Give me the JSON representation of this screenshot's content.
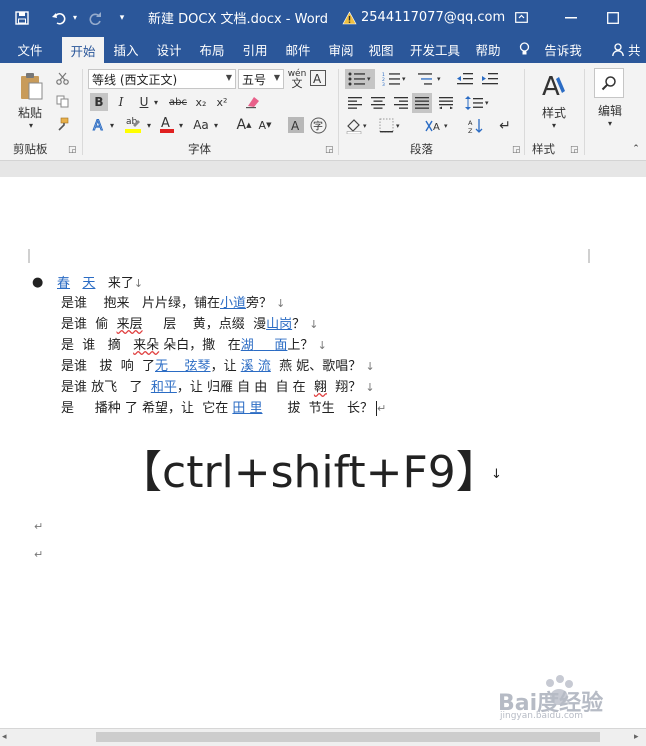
{
  "titlebar": {
    "title": "新建 DOCX 文档.docx  -  Word",
    "account": "2544117077@qq.com"
  },
  "tabs": [
    "文件",
    "开始",
    "插入",
    "设计",
    "布局",
    "引用",
    "邮件",
    "审阅",
    "视图",
    "开发工具",
    "帮助",
    "告诉我",
    "共"
  ],
  "ribbon": {
    "clipboard": {
      "paste": "粘贴",
      "label": "剪贴板"
    },
    "font": {
      "font_name": "等线 (西文正文)",
      "font_size": "五号",
      "wen": "wén",
      "bold": "B",
      "italic": "I",
      "underline": "U",
      "strike": "abc",
      "sub": "x₂",
      "sup": "x²",
      "grow": "A",
      "shrink": "A",
      "case": "Aa",
      "label": "字体"
    },
    "paragraph": {
      "label": "段落"
    },
    "styles": {
      "button": "样式",
      "label": "样式"
    },
    "editing": {
      "button": "编辑"
    }
  },
  "document": {
    "line1": {
      "a": "春",
      "b": "天",
      "c": "来了",
      "mark": "↓"
    },
    "line2": {
      "a": "是谁",
      "b": "抱来",
      "c": "片片绿，铺在",
      "link": "小道",
      "d": "旁？",
      "mark": "↓"
    },
    "line3": {
      "a": "是谁",
      "b": "偷",
      "c": "来层",
      "d": "层",
      "e": "黄，点缀",
      "f": "漫",
      "link": "山岗",
      "g": "？",
      "mark": "↓"
    },
    "line4": {
      "a": "是",
      "b": "谁",
      "c": "摘",
      "d": "来朵",
      "e": "朵白，撒",
      "f": "在",
      "link1": "湖",
      "link2": "面",
      "g": "上？",
      "mark": "↓"
    },
    "line5": {
      "a": "是谁",
      "b": "拔",
      "c": "响",
      "d": "了",
      "link1": "无",
      "link2": "弦琴",
      "e": "，让",
      "link3": "溪 流",
      "f": "燕",
      "g": "妮、歌唱？",
      "mark": "↓"
    },
    "line6": {
      "a": "是谁 放飞",
      "b": "了",
      "link": "和平",
      "c": "，让 归雁 自 由",
      "d": "自 在",
      "e": "翱",
      "f": "翔？",
      "mark": "↓"
    },
    "line7": {
      "a": "是",
      "b": "播种 了 希望，让",
      "c": "它在",
      "link": "田 里",
      "d": "拔",
      "e": "节生",
      "f": "长？",
      "mark": "↵"
    },
    "big": "【ctrl+shift+F9】",
    "big_mark": "↓",
    "para1": "↵",
    "para2": "↵"
  },
  "watermark": {
    "text": "Bai度经验",
    "sub": "jingyan.baidu.com"
  }
}
